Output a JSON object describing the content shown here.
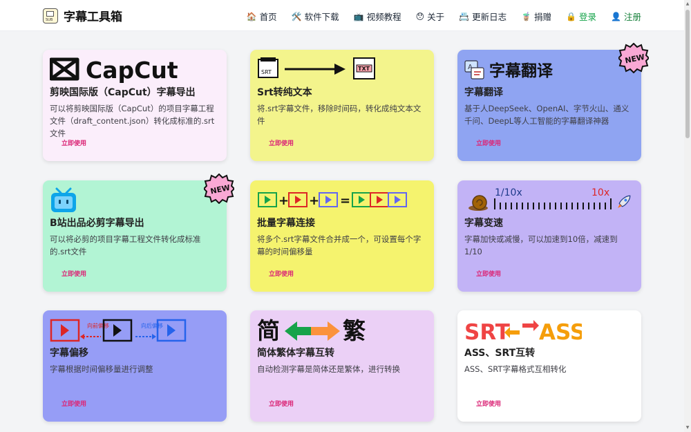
{
  "header": {
    "brand": "字幕工具箱",
    "logo_text": "SUB",
    "nav": [
      {
        "icon": "🏠",
        "label": "首页"
      },
      {
        "icon": "🛠️",
        "label": "软件下载"
      },
      {
        "icon": "📺",
        "label": "视频教程"
      },
      {
        "icon": "😯",
        "label": "关于"
      },
      {
        "icon": "📇",
        "label": "更新日志"
      },
      {
        "icon": "🧋",
        "label": "捐赠"
      },
      {
        "icon": "🔒",
        "label": "登录"
      },
      {
        "icon": "👤",
        "label": "注册"
      }
    ]
  },
  "badge_text": "NEW",
  "cards": [
    {
      "title": "剪映国际版（CapCut）字幕导出",
      "desc": "可以将剪映国际版（CapCut）的项目字幕工程文件（draft_content.json）转化成标准的.srt文件",
      "button": "立即使用",
      "art_text": "CapCut",
      "color": "#fbeefb"
    },
    {
      "title": "Srt转纯文本",
      "desc": "将.srt字幕文件，移除时间码，转化成纯文本文件",
      "button": "立即使用",
      "art_left": "SRT",
      "art_right": "TXT",
      "color": "#f3f48c"
    },
    {
      "title": "字幕翻译",
      "desc": "基于人DeepSeek、OpenAI、字节火山、通义千问、DeepL等人工智能的字幕翻译神器",
      "button": "立即使用",
      "art_text": "字幕翻译",
      "color": "#8fa4f2"
    },
    {
      "title": "B站出品必剪字幕导出",
      "desc": "可以将必剪的项目字幕工程文件转化成标准的.srt文件",
      "button": "立即使用",
      "color": "#b2f4d4"
    },
    {
      "title": "批量字幕连接",
      "desc": "将多个.srt字幕文件合并成一个，可设置每个字幕的时间偏移量",
      "button": "立即使用",
      "color": "#f5f36e"
    },
    {
      "title": "字幕变速",
      "desc": "字幕加快或减慢，可以加速到10倍，减速到1/10",
      "button": "立即使用",
      "art_left": "1/10x",
      "art_right": "10x",
      "color": "#c2b3f6"
    },
    {
      "title": "字幕偏移",
      "desc": "字幕根据时间偏移量进行调整",
      "button": "立即使用",
      "art_left": "向前偏移",
      "art_right": "向后偏移",
      "color": "#969df6"
    },
    {
      "title": "简体繁体字幕互转",
      "desc": "自动检测字幕是简体还是繁体，进行转换",
      "button": "立即使用",
      "art_left": "简",
      "art_right": "繁",
      "color": "#ebd0f6"
    },
    {
      "title": "ASS、SRT互转",
      "desc": "ASS、SRT字幕格式互相转化",
      "button": "立即使用",
      "art_left": "SRT",
      "art_right": "ASS",
      "color": "#ffffff"
    }
  ]
}
